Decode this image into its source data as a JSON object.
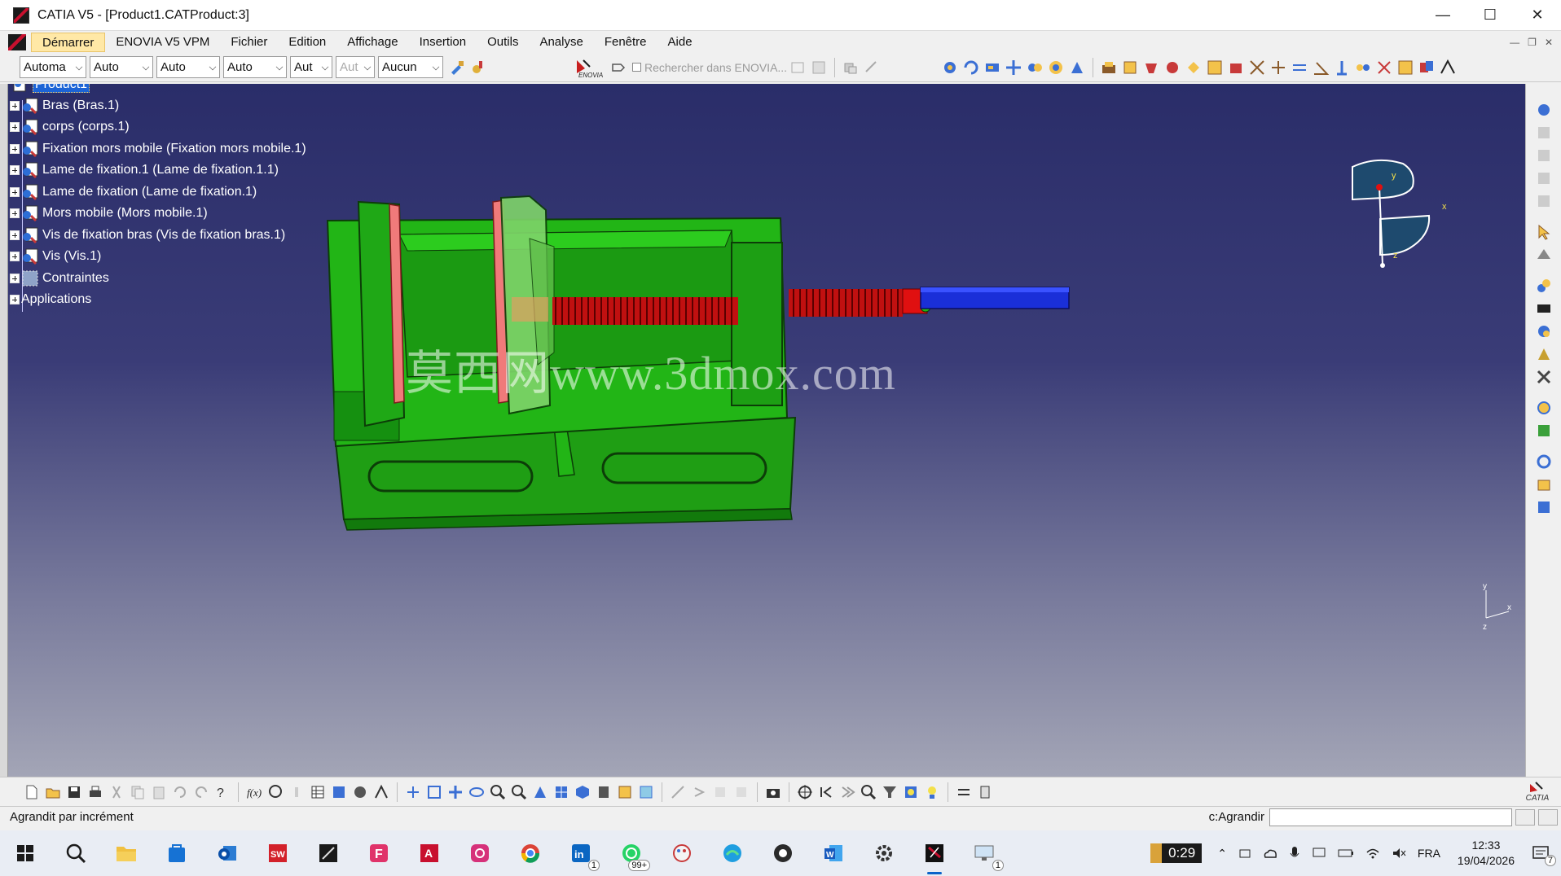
{
  "window": {
    "title": "CATIA V5 - [Product1.CATProduct:3]"
  },
  "menubar": {
    "items": [
      "Démarrer",
      "ENOVIA V5 VPM",
      "Fichier",
      "Edition",
      "Affichage",
      "Insertion",
      "Outils",
      "Analyse",
      "Fenêtre",
      "Aide"
    ]
  },
  "toolbar_top": {
    "combos": [
      "Automa",
      "Auto",
      "Auto",
      "Auto",
      "Aut",
      "Aut",
      "Aucun"
    ],
    "search_placeholder": "Rechercher dans ENOVIA..."
  },
  "tree": {
    "root": "Product1",
    "children": [
      "Bras (Bras.1)",
      "corps (corps.1)",
      "Fixation mors mobile (Fixation mors mobile.1)",
      "Lame de fixation.1 (Lame de fixation.1.1)",
      "Lame de fixation (Lame de fixation.1)",
      "Mors mobile (Mors mobile.1)",
      "Vis de fixation bras (Vis de fixation bras.1)",
      "Vis (Vis.1)",
      "Contraintes"
    ],
    "applications": "Applications"
  },
  "viewport": {
    "watermark": "莫西网www.3dmox.com",
    "compass_labels": {
      "y": "y",
      "x": "x",
      "z": "z"
    },
    "axis_labels": {
      "y": "y",
      "x": "x",
      "z": "z"
    }
  },
  "statusbar": {
    "message": "Agrandit par incrément",
    "command_label": "c:Agrandir"
  },
  "taskbar": {
    "timer": "0:29",
    "badges": {
      "linkedin": "1",
      "whatsapp": "99+",
      "monitor": "1"
    },
    "language": "FRA",
    "time": "12:33",
    "date": "19/04/2026",
    "notifications": "7"
  },
  "colors": {
    "accent_menu": "#ffe8a6",
    "viewport_top": "#2a2d69",
    "viewport_bottom": "#a3a5b6",
    "vise_green": "#22b516",
    "screw_red": "#e01010",
    "handle_blue": "#1a2fd8"
  },
  "logo_text": "CATIA",
  "enovia_text": "ENOVIA"
}
